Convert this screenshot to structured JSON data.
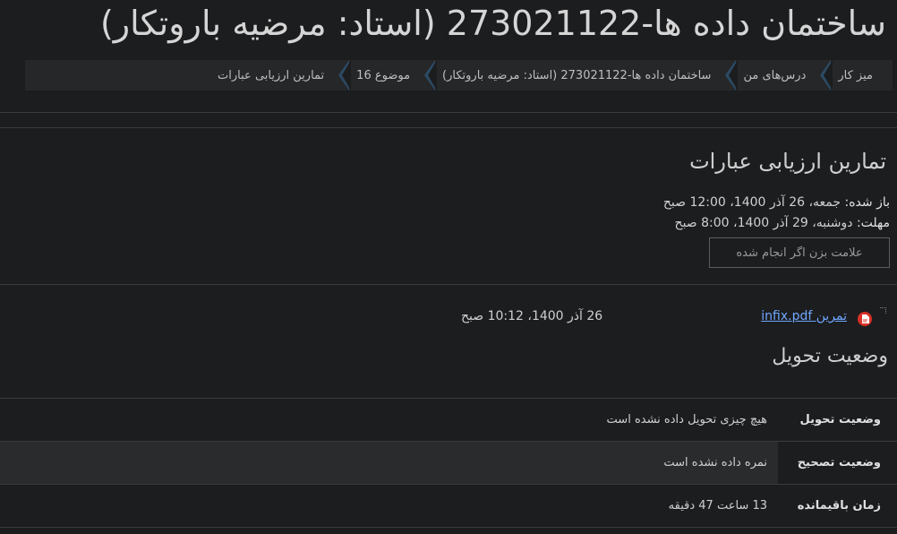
{
  "page": {
    "title": "ساختمان داده ها-273021122 (استاد: مرضیه باروتکار)"
  },
  "breadcrumb": [
    {
      "label": "میز کار"
    },
    {
      "label": "درس‌های من"
    },
    {
      "label": "ساختمان داده ها-273021122 (استاد: مرضیه باروتکار)"
    },
    {
      "label": "موضوع 16"
    },
    {
      "label": "تمارین ارزیابی عبارات"
    }
  ],
  "activity": {
    "title": "تمارین ارزیابی عبارات",
    "opened_label": "باز شده:",
    "opened_value": "جمعه، 26 آذر 1400، 12:00 صبح",
    "due_label": "مهلت:",
    "due_value": "دوشنبه، 29 آذر 1400، 8:00 صبح",
    "mark_done_label": "علامت بزن اگر انجام شده"
  },
  "attachment": {
    "icon": "pdf-icon",
    "filename": "تمرین infix.pdf",
    "date": "26 آذر 1400، 10:12 صبح"
  },
  "submission": {
    "heading": "وضعیت تحویل",
    "rows": [
      {
        "label": "وضعیت تحویل",
        "value": "هیچ چیزی تحویل داده نشده است"
      },
      {
        "label": "وضعیت تصحیح",
        "value": "نمره داده نشده است"
      },
      {
        "label": "زمان باقیمانده",
        "value": "13 ساعت 47 دقیقه"
      }
    ]
  },
  "colors": {
    "background": "#1c1d1f",
    "link": "#6fa8ff",
    "pdf_icon": "#d93025",
    "breadcrumb_separator": "#2c4a63"
  }
}
